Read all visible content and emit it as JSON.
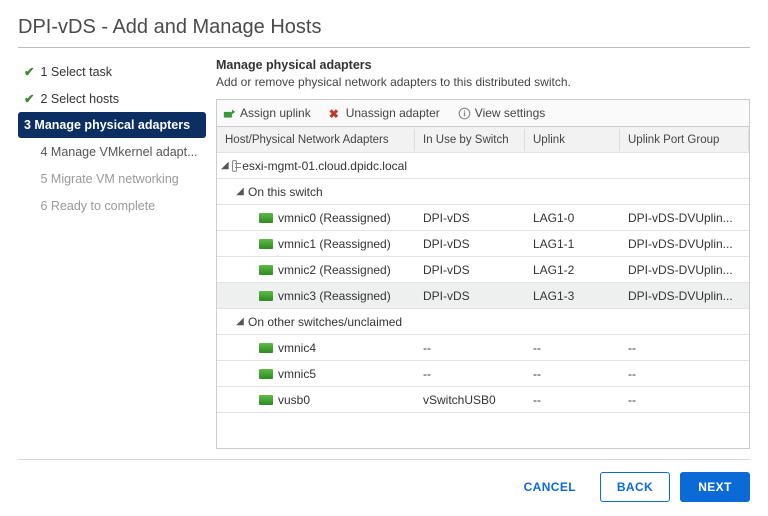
{
  "title": "DPI-vDS - Add and Manage Hosts",
  "steps": [
    {
      "label": "1 Select task",
      "state": "completed"
    },
    {
      "label": "2 Select hosts",
      "state": "completed"
    },
    {
      "label": "3 Manage physical adapters",
      "state": "active"
    },
    {
      "label": "4 Manage VMkernel adapt...",
      "state": "pending"
    },
    {
      "label": "5 Migrate VM networking",
      "state": "future"
    },
    {
      "label": "6 Ready to complete",
      "state": "future"
    }
  ],
  "main": {
    "heading": "Manage physical adapters",
    "sub": "Add or remove physical network adapters to this distributed switch."
  },
  "toolbar": {
    "assign": "Assign uplink",
    "unassign": "Unassign adapter",
    "view": "View settings"
  },
  "columns": {
    "c1": "Host/Physical Network Adapters",
    "c2": "In Use by Switch",
    "c3": "Uplink",
    "c4": "Uplink Port Group"
  },
  "host": {
    "name": "esxi-mgmt-01.cloud.dpidc.local",
    "group_on": "On this switch",
    "group_other": "On other switches/unclaimed"
  },
  "rows_on": [
    {
      "name": "vmnic0 (Reassigned)",
      "switch": "DPI-vDS",
      "uplink": "LAG1-0",
      "pg": "DPI-vDS-DVUplin..."
    },
    {
      "name": "vmnic1 (Reassigned)",
      "switch": "DPI-vDS",
      "uplink": "LAG1-1",
      "pg": "DPI-vDS-DVUplin..."
    },
    {
      "name": "vmnic2 (Reassigned)",
      "switch": "DPI-vDS",
      "uplink": "LAG1-2",
      "pg": "DPI-vDS-DVUplin..."
    },
    {
      "name": "vmnic3 (Reassigned)",
      "switch": "DPI-vDS",
      "uplink": "LAG1-3",
      "pg": "DPI-vDS-DVUplin..."
    }
  ],
  "rows_other": [
    {
      "name": "vmnic4",
      "switch": "--",
      "uplink": "--",
      "pg": "--"
    },
    {
      "name": "vmnic5",
      "switch": "--",
      "uplink": "--",
      "pg": "--"
    },
    {
      "name": "vusb0",
      "switch": "vSwitchUSB0",
      "uplink": "--",
      "pg": "--"
    }
  ],
  "buttons": {
    "cancel": "CANCEL",
    "back": "BACK",
    "next": "NEXT"
  }
}
